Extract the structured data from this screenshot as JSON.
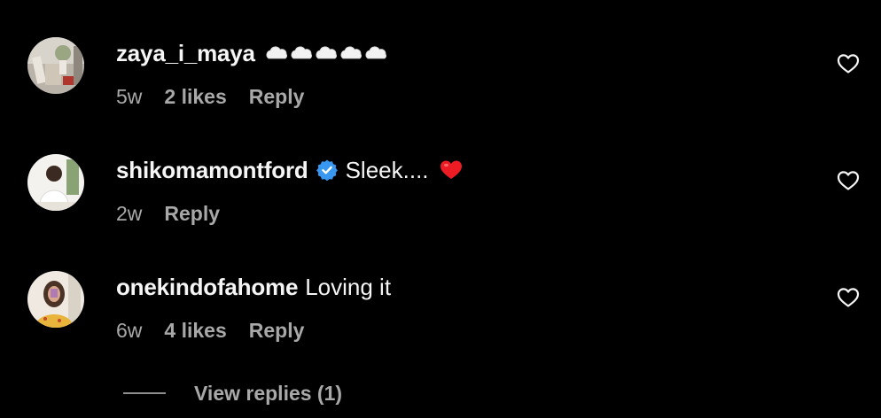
{
  "colors": {
    "background": "#000000",
    "primary_text": "#f5f5f5",
    "secondary_text": "#a8a8a8",
    "verified_badge": "#3897f0",
    "heart_emoji": "#ed1c24"
  },
  "comments": [
    {
      "username": "zaya_i_maya",
      "text": "",
      "emoji": "cloud-emoji x5",
      "verified": false,
      "time": "5w",
      "likes": "2 likes",
      "reply_label": "Reply",
      "like_icon": "heart-outline-icon"
    },
    {
      "username": "shikomamontford",
      "text": "Sleek....",
      "emoji": "red-heart-emoji",
      "verified": true,
      "time": "2w",
      "likes": "",
      "reply_label": "Reply",
      "like_icon": "heart-outline-icon"
    },
    {
      "username": "onekindofahome",
      "text": "Loving it",
      "emoji": "",
      "verified": false,
      "time": "6w",
      "likes": "4 likes",
      "reply_label": "Reply",
      "like_icon": "heart-outline-icon"
    }
  ],
  "view_replies": {
    "label": "View replies (1)"
  }
}
